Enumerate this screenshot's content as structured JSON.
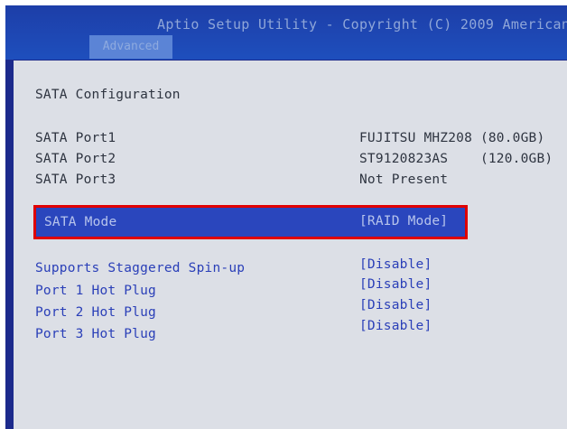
{
  "header": {
    "title": "Aptio Setup Utility - Copyright (C) 2009 American",
    "active_tab": "Advanced"
  },
  "section_title": "SATA Configuration",
  "ports": [
    {
      "label": "SATA Port1",
      "value": "FUJITSU MHZ208 (80.0GB)"
    },
    {
      "label": "SATA Port2",
      "value": "ST9120823AS    (120.0GB)"
    },
    {
      "label": "SATA Port3",
      "value": "Not Present"
    }
  ],
  "sata_mode": {
    "label": "SATA Mode",
    "value": "[RAID Mode]"
  },
  "options": [
    {
      "label": "Supports Staggered Spin-up",
      "value": "[Disable]"
    },
    {
      "label": "Port 1 Hot Plug",
      "value": "[Disable]"
    },
    {
      "label": "Port 2 Hot Plug",
      "value": "[Disable]"
    },
    {
      "label": "Port 3 Hot Plug",
      "value": "[Disable]"
    }
  ],
  "colors": {
    "background": "#1c2a8c",
    "panel": "#dcdfe6",
    "highlight_bar": "#2a46bd",
    "highlight_border": "#e00000",
    "option_text": "#2a3fb8"
  }
}
